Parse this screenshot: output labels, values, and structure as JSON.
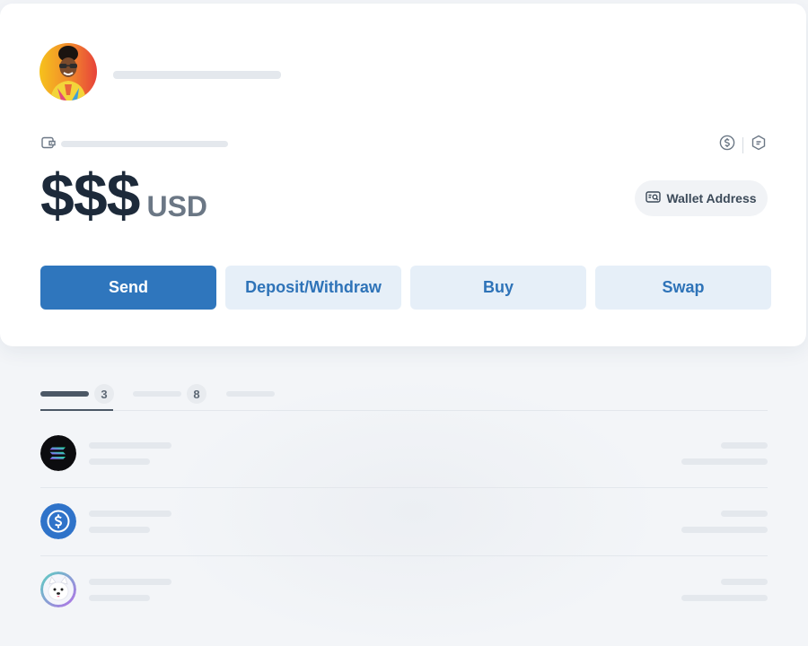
{
  "balance": {
    "amount": "$$$",
    "currency": "USD"
  },
  "wallet_address_button": {
    "label": "Wallet Address",
    "icon": "wallet-address-icon"
  },
  "header_icons": [
    "dollar-circle-icon",
    "token-tag-icon"
  ],
  "actions": [
    {
      "label": "Send"
    },
    {
      "label": "Deposit/Withdraw"
    },
    {
      "label": "Buy"
    },
    {
      "label": "Swap"
    }
  ],
  "tabs": [
    {
      "count": "3"
    },
    {
      "count": "8"
    },
    {
      "count": ""
    }
  ],
  "tokens": [
    {
      "icon": "solana-icon"
    },
    {
      "icon": "usdc-icon"
    },
    {
      "icon": "samoyed-coin-icon"
    }
  ],
  "colors": {
    "primary": "#2f76bd",
    "secondary_button_bg": "#e6eff8",
    "text_dark": "#1d2a3a"
  }
}
